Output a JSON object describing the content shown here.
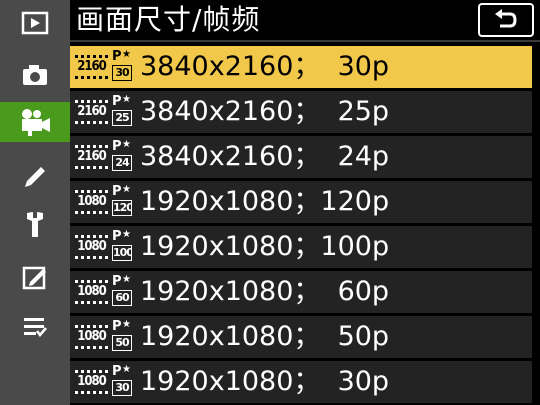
{
  "header": {
    "title": "画面尺寸/帧频",
    "back_icon": "back-arrow-icon"
  },
  "sidebar": {
    "items": [
      {
        "name": "playback-icon",
        "active": false
      },
      {
        "name": "camera-icon",
        "active": false
      },
      {
        "name": "movie-camera-icon",
        "active": true
      },
      {
        "name": "pencil-icon",
        "active": false
      },
      {
        "name": "wrench-icon",
        "active": false
      },
      {
        "name": "retouch-icon",
        "active": false
      },
      {
        "name": "my-menu-icon",
        "active": false
      }
    ],
    "active_color": "#4a9a1e"
  },
  "menu": {
    "selected_index": 0,
    "highlight_color": "#f2c84a",
    "items": [
      {
        "badge": "2160",
        "fps_icon": "30",
        "label": "3840x2160；  30p"
      },
      {
        "badge": "2160",
        "fps_icon": "25",
        "label": "3840x2160；  25p"
      },
      {
        "badge": "2160",
        "fps_icon": "24",
        "label": "3840x2160；  24p"
      },
      {
        "badge": "1080",
        "fps_icon": "120",
        "label": "1920x1080；120p"
      },
      {
        "badge": "1080",
        "fps_icon": "100",
        "label": "1920x1080；100p"
      },
      {
        "badge": "1080",
        "fps_icon": "60",
        "label": "1920x1080；  60p"
      },
      {
        "badge": "1080",
        "fps_icon": "50",
        "label": "1920x1080；  50p"
      },
      {
        "badge": "1080",
        "fps_icon": "30",
        "label": "1920x1080；  30p"
      }
    ]
  }
}
